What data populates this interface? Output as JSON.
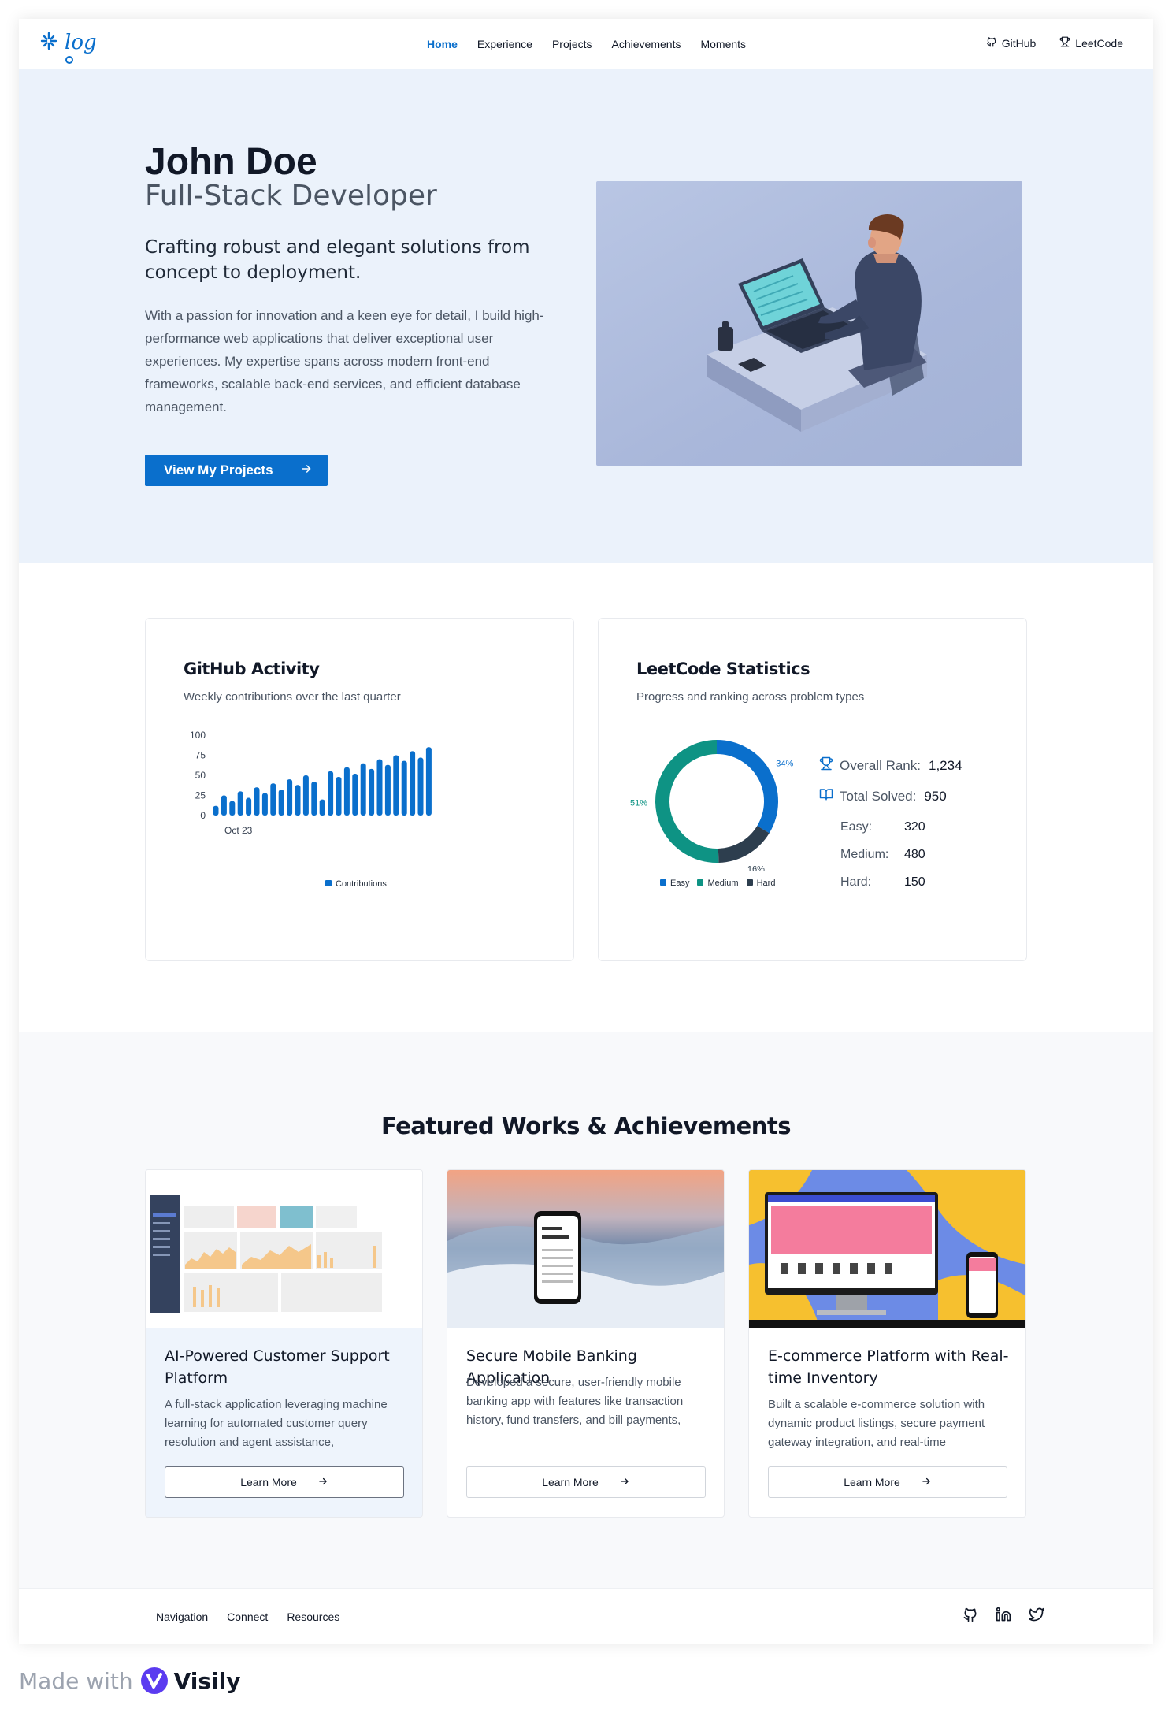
{
  "nav": {
    "logo_text": "log",
    "links": [
      "Home",
      "Experience",
      "Projects",
      "Achievements",
      "Moments"
    ],
    "github": "GitHub",
    "leetcode": "LeetCode"
  },
  "hero": {
    "name": "John Doe",
    "role": "Full-Stack Developer",
    "tagline": "Crafting robust and elegant solutions from concept to deployment.",
    "description": "With a passion for innovation and a keen eye for detail, I build high-performance web applications that deliver exceptional user experiences. My expertise spans across modern front-end frameworks, scalable back-end services, and efficient database management.",
    "cta": "View My Projects"
  },
  "github_card": {
    "title": "GitHub Activity",
    "subtitle": "Weekly contributions over the last quarter"
  },
  "leetcode_card": {
    "title": "LeetCode Statistics",
    "subtitle": "Progress and ranking across problem types",
    "overall_rank_label": "Overall Rank:",
    "overall_rank": "1,234",
    "total_solved_label": "Total Solved:",
    "total_solved": "950",
    "easy_label": "Easy:",
    "easy": "320",
    "medium_label": "Medium:",
    "medium": "480",
    "hard_label": "Hard:",
    "hard": "150"
  },
  "chart_data": [
    {
      "type": "bar",
      "title": "GitHub Activity",
      "categories": [
        "Oct 23",
        "",
        "",
        "",
        "",
        "",
        "",
        "",
        "",
        "",
        "",
        "",
        "",
        "",
        "",
        "",
        "",
        "",
        "",
        "",
        "",
        "",
        "",
        "",
        "",
        "",
        "",
        "",
        "",
        "",
        "",
        ""
      ],
      "series": [
        {
          "name": "Contributions",
          "values": [
            12,
            25,
            18,
            30,
            22,
            35,
            28,
            40,
            32,
            45,
            38,
            50,
            42,
            20,
            55,
            48,
            60,
            52,
            65,
            58,
            70,
            63,
            75,
            68,
            80,
            72,
            85
          ]
        }
      ],
      "yticks": [
        0,
        25,
        50,
        75,
        100
      ],
      "ylim": [
        0,
        100
      ],
      "xtick_label": "Oct 23",
      "legend": "bottom",
      "color": "#0a6fcc"
    },
    {
      "type": "pie",
      "title": "LeetCode Statistics",
      "donut": true,
      "categories": [
        "Easy",
        "Medium",
        "Hard"
      ],
      "values": [
        34,
        51,
        16
      ],
      "value_labels": [
        "34%",
        "51%",
        "16%"
      ],
      "colors": [
        "#0a6fcc",
        "#0e9384",
        "#2d3e4e"
      ],
      "legend": "bottom"
    }
  ],
  "featured": {
    "title": "Featured Works & Achievements",
    "works": [
      {
        "title": "AI-Powered Customer Support Platform",
        "desc": "A full-stack application leveraging machine learning for automated customer query resolution and agent assistance,",
        "button": "Learn More"
      },
      {
        "title": "Secure Mobile Banking Application",
        "desc": "Developed a secure, user-friendly mobile banking app with features like transaction history, fund transfers, and bill payments,",
        "button": "Learn More"
      },
      {
        "title": "E-commerce Platform with Real-time Inventory",
        "desc": "Built a scalable e-commerce solution with dynamic product listings, secure payment gateway integration, and real-time",
        "button": "Learn More"
      }
    ]
  },
  "footer": {
    "links": [
      "Navigation",
      "Connect",
      "Resources"
    ]
  },
  "made_with": {
    "prefix": "Made with",
    "brand": "Visily"
  }
}
